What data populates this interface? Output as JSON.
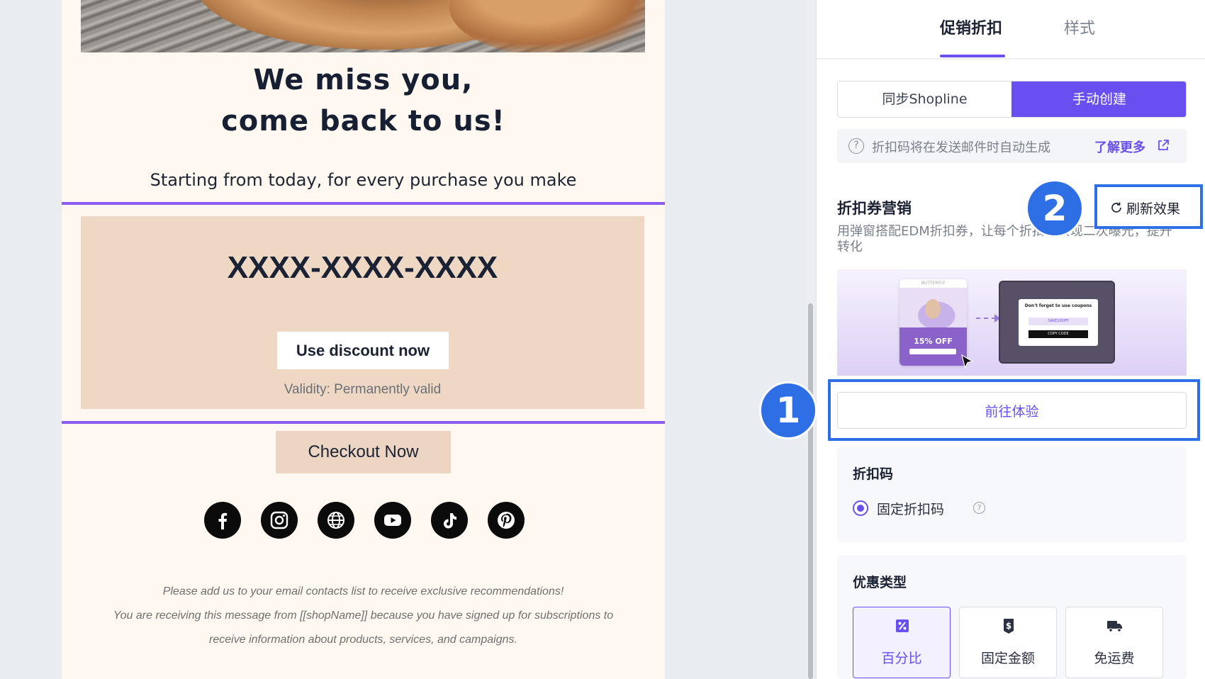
{
  "email": {
    "headline_line1": "We miss you,",
    "headline_line2": "come back to us!",
    "subline": "Starting from today, for every purchase you make",
    "coupon_code": "XXXX-XXXX-XXXX",
    "use_button": "Use discount now",
    "validity": "Validity: Permanently valid",
    "checkout_button": "Checkout Now",
    "social_icons": [
      "facebook-icon",
      "instagram-icon",
      "website-icon",
      "youtube-icon",
      "tiktok-icon",
      "pinterest-icon"
    ],
    "footer_line1": "Please add us to your email contacts list to receive exclusive recommendations!",
    "footer_line2": "You are receiving this message from [[shopName]] because you have signed up for subscriptions to",
    "footer_line3": "receive information about products, services, and campaigns."
  },
  "panel": {
    "tabs": [
      {
        "label": "促销折扣",
        "active": true
      },
      {
        "label": "样式",
        "active": false
      }
    ],
    "segment": {
      "sync_label": "同步Shopline",
      "manual_label": "手动创建",
      "selected": "手动创建"
    },
    "hint": {
      "text": "折扣码将在发送邮件时自动生成",
      "link": "了解更多"
    },
    "section": {
      "title": "折扣券营销",
      "refresh_label": "刷新效果",
      "description": "用弹窗搭配EDM折扣券，让每个折扣码实现二次曝光，提升转化"
    },
    "promo_image": {
      "brand": "BUTTERFLY",
      "offer": "15% OFF",
      "modal_title": "Don't forget to use coupons",
      "modal_code": "SAVE10OFF",
      "modal_button": "COPY CODE"
    },
    "goto_button": "前往体验",
    "code_box": {
      "title": "折扣码",
      "option": "固定折扣码",
      "help": "?"
    },
    "type_box": {
      "title": "优惠类型",
      "options": [
        {
          "label": "百分比",
          "icon": "percent-icon",
          "selected": true
        },
        {
          "label": "固定金额",
          "icon": "dollar-tag-icon",
          "selected": false
        },
        {
          "label": "免运费",
          "icon": "truck-icon",
          "selected": false
        }
      ]
    }
  },
  "annotations": {
    "badge1": "1",
    "badge2": "2"
  },
  "colors": {
    "accent": "#6a4ff0",
    "highlight": "#2f6fe6",
    "email_bg": "#fef8f0",
    "coupon_bg": "#eed8c4"
  }
}
